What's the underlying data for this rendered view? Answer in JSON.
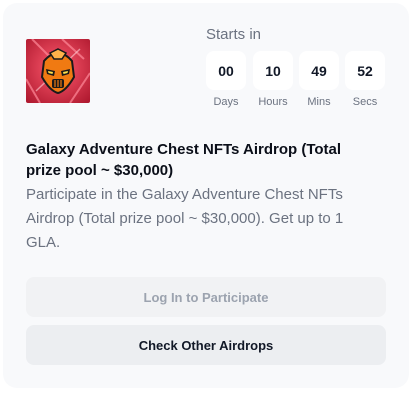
{
  "countdown": {
    "heading": "Starts in",
    "days": "00",
    "hours": "10",
    "mins": "49",
    "secs": "52",
    "days_label": "Days",
    "hours_label": "Hours",
    "mins_label": "Mins",
    "secs_label": "Secs"
  },
  "airdrop": {
    "title": "Galaxy Adventure Chest NFTs Airdrop (Total prize pool ~ $30,000)",
    "description": "Participate in the Galaxy Adventure Chest NFTs Airdrop (Total prize pool ~ $30,000). Get up to 1 GLA.",
    "logo_icon": "robot-mask-icon"
  },
  "actions": {
    "login_label": "Log In to Participate",
    "check_label": "Check Other Airdrops"
  },
  "colors": {
    "card_bg": "#f8f9fb",
    "login_text": "#9ca3af",
    "muted_text": "#6b7280",
    "logo_bg": "#c0233a",
    "mask_orange": "#f07a12"
  }
}
